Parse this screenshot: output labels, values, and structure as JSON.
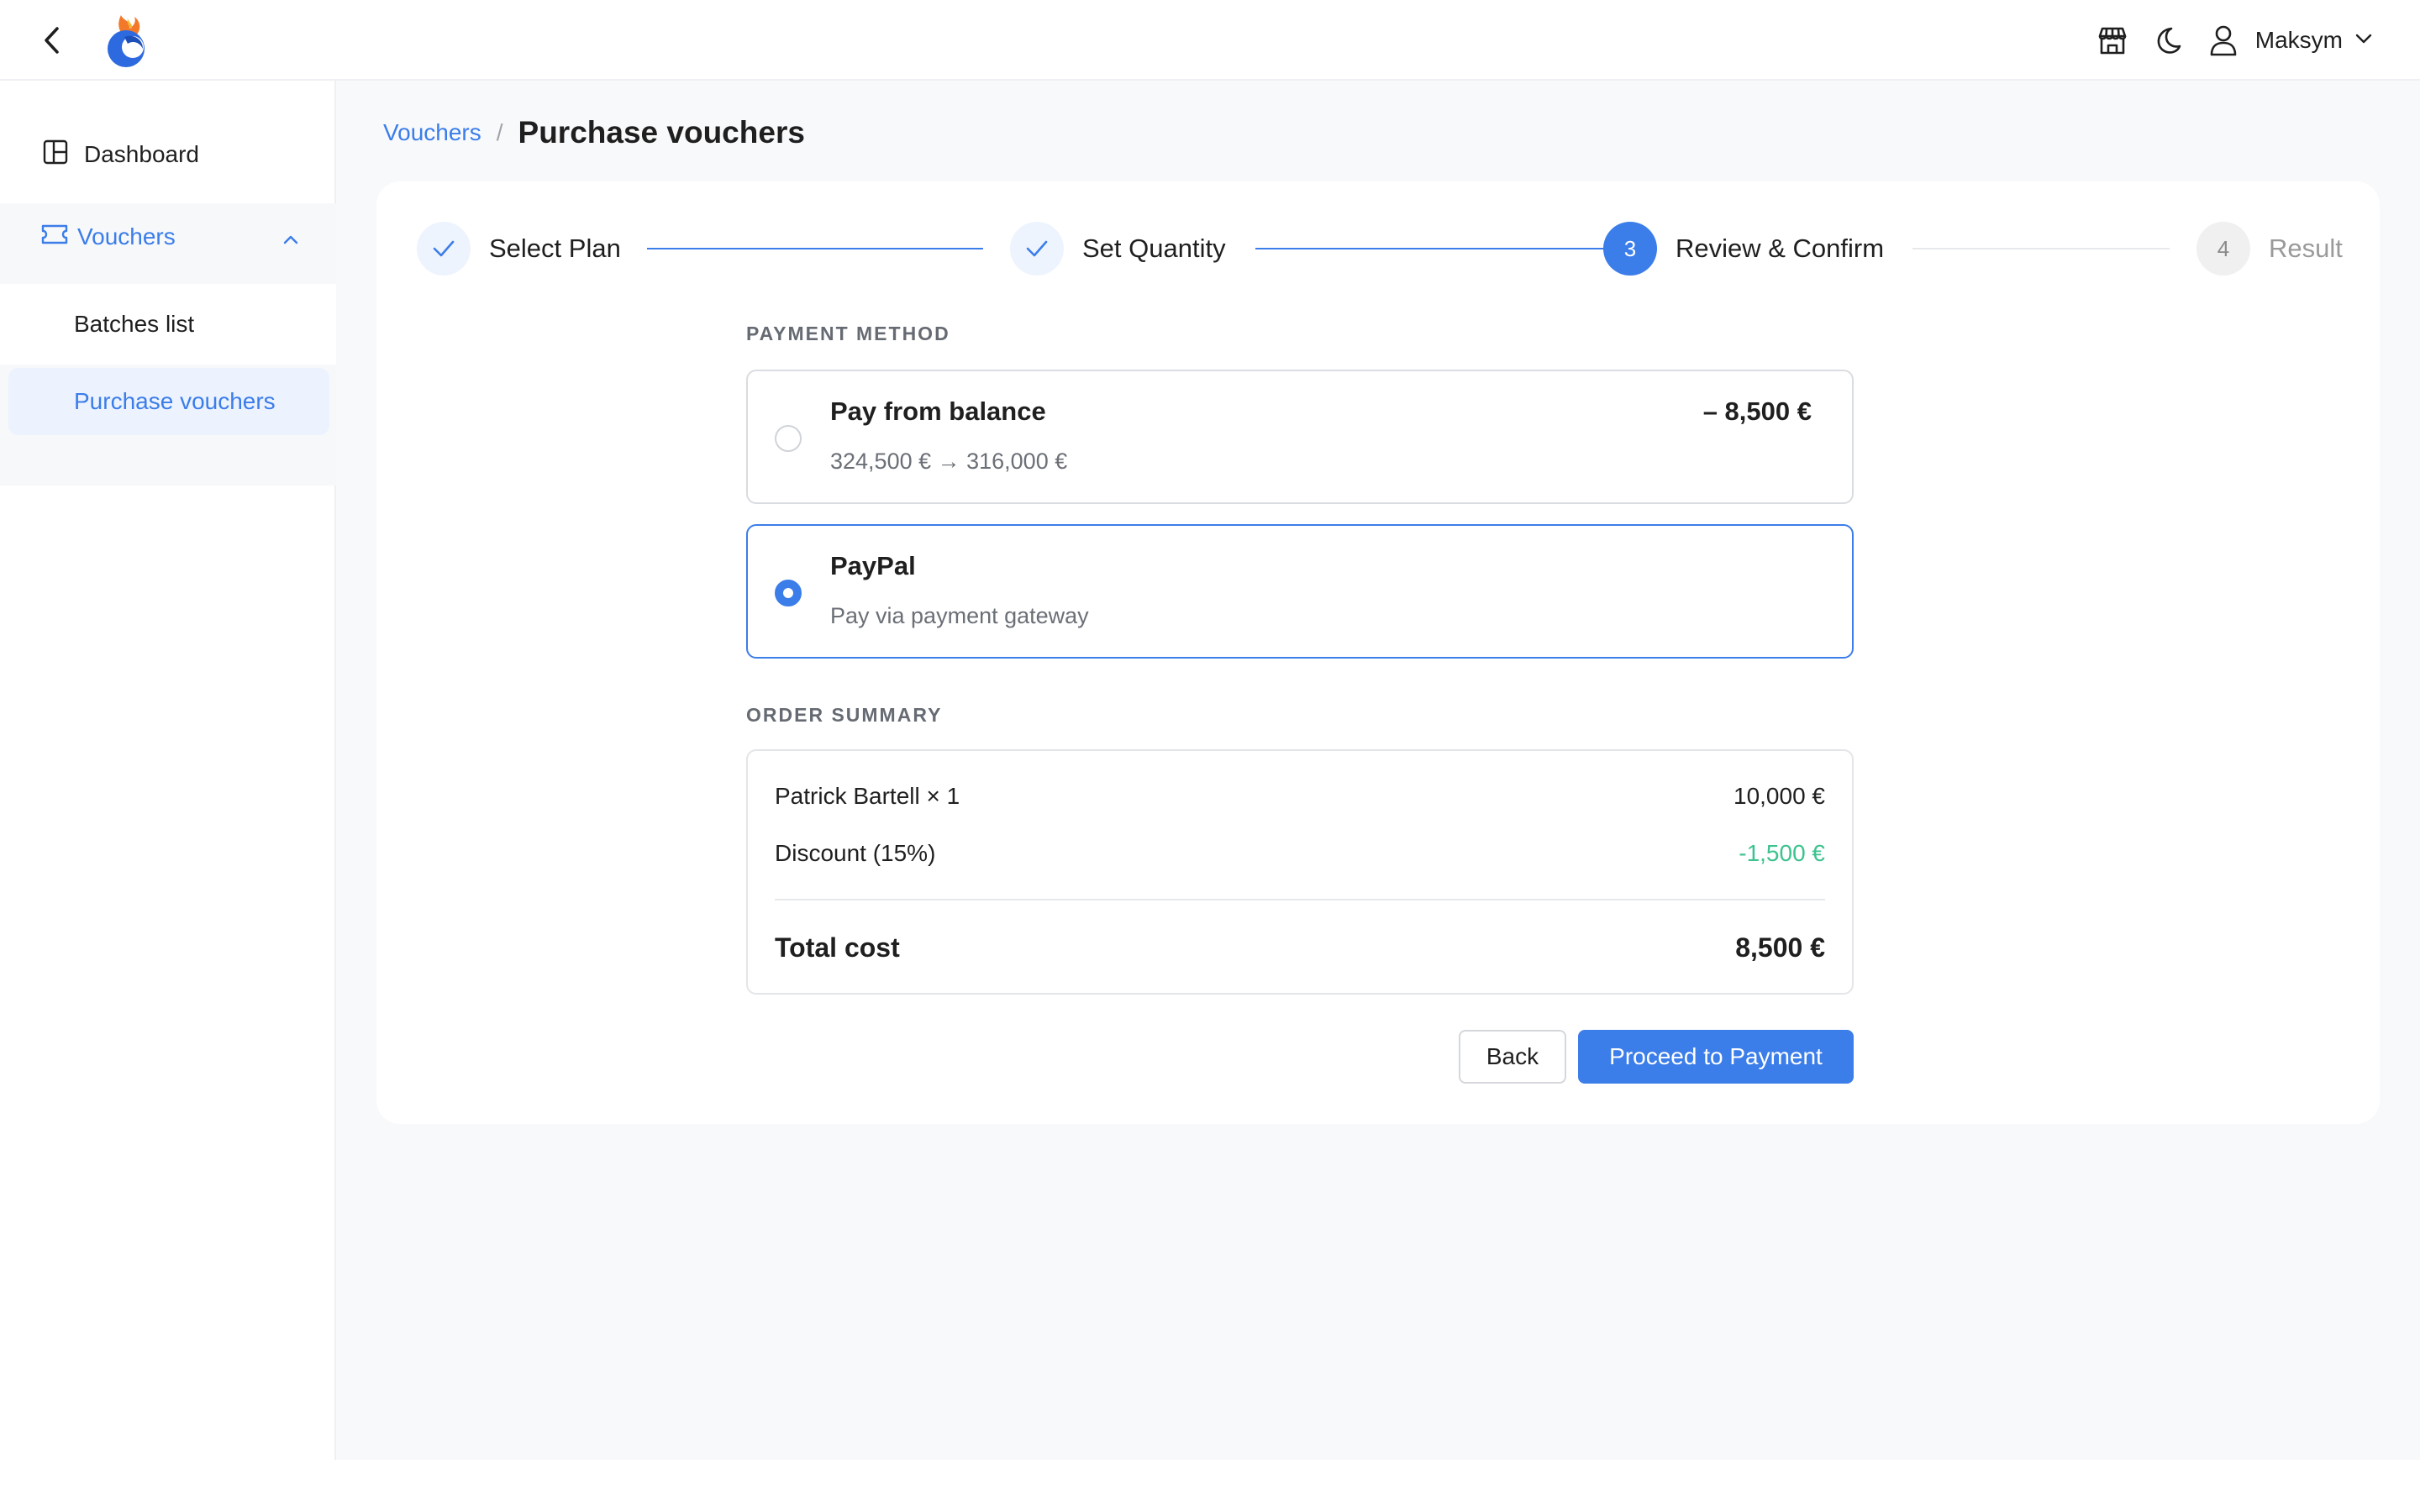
{
  "header": {
    "user_name": "Maksym",
    "icons": [
      "back-arrow-icon",
      "app-logo",
      "store-icon",
      "moon-icon",
      "user-icon",
      "chevron-down-icon"
    ]
  },
  "sidebar": {
    "items": [
      {
        "label": "Dashboard",
        "icon": "dashboard-icon"
      },
      {
        "label": "Vouchers",
        "icon": "ticket-icon",
        "expanded": true
      },
      {
        "label": "Batches list"
      },
      {
        "label": "Purchase vouchers",
        "active": true
      }
    ]
  },
  "breadcrumb": {
    "parent": "Vouchers",
    "separator": "/",
    "current": "Purchase vouchers"
  },
  "steps": [
    {
      "label": "Select Plan",
      "state": "done"
    },
    {
      "label": "Set Quantity",
      "state": "done"
    },
    {
      "number": "3",
      "label": "Review & Confirm",
      "state": "active"
    },
    {
      "number": "4",
      "label": "Result",
      "state": "pending"
    }
  ],
  "payment": {
    "section_title": "PAYMENT METHOD",
    "options": [
      {
        "title": "Pay from balance",
        "subtitle": "324,500 € → 316,000 €",
        "amount": "– 8,500 €",
        "selected": false
      },
      {
        "title": "PayPal",
        "subtitle": "Pay via payment gateway",
        "selected": true
      }
    ]
  },
  "summary": {
    "section_title": "ORDER SUMMARY",
    "rows": [
      {
        "label": "Patrick Bartell × 1",
        "value": "10,000 €"
      },
      {
        "label": "Discount (15%)",
        "value": "-1,500 €"
      }
    ],
    "total_label": "Total cost",
    "total_value": "8,500 €"
  },
  "actions": {
    "back": "Back",
    "proceed": "Proceed to Payment"
  },
  "colors": {
    "accent": "#3b7de9",
    "discount": "#3cc28f",
    "page_bg": "#f8f9fb"
  }
}
